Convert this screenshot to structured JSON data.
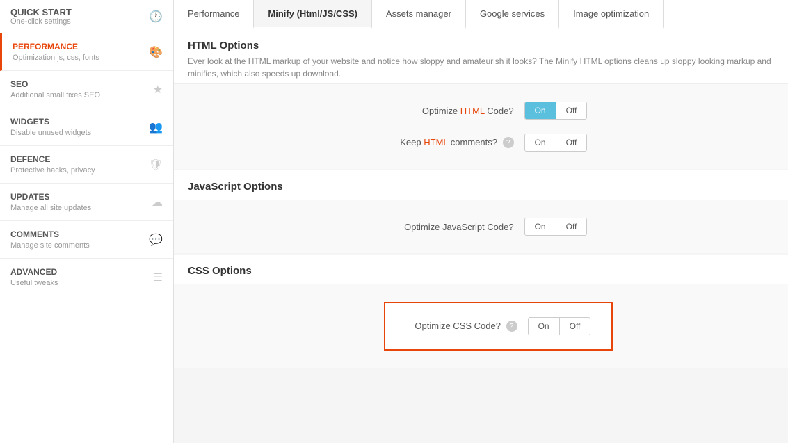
{
  "sidebar": {
    "quick_start": {
      "title": "QUICK START",
      "subtitle": "One-click settings"
    },
    "items": [
      {
        "id": "performance",
        "title": "PERFORMANCE",
        "subtitle": "Optimization js, css, fonts",
        "icon": "🎨",
        "active": true
      },
      {
        "id": "seo",
        "title": "SEO",
        "subtitle": "Additional small fixes SEO",
        "icon": "★",
        "active": false
      },
      {
        "id": "widgets",
        "title": "WIDGETS",
        "subtitle": "Disable unused widgets",
        "icon": "👥",
        "active": false
      },
      {
        "id": "defence",
        "title": "DEFENCE",
        "subtitle": "Protective hacks, privacy",
        "icon": "🛡",
        "active": false
      },
      {
        "id": "updates",
        "title": "UPDATES",
        "subtitle": "Manage all site updates",
        "icon": "☁",
        "active": false
      },
      {
        "id": "comments",
        "title": "COMMENTS",
        "subtitle": "Manage site comments",
        "icon": "💬",
        "active": false
      },
      {
        "id": "advanced",
        "title": "ADVANCED",
        "subtitle": "Useful tweaks",
        "icon": "☰",
        "active": false
      }
    ]
  },
  "tabs": [
    {
      "id": "performance",
      "label": "Performance",
      "active": false
    },
    {
      "id": "minify",
      "label": "Minify (Html/JS/CSS)",
      "active": true
    },
    {
      "id": "assets",
      "label": "Assets manager",
      "active": false
    },
    {
      "id": "google",
      "label": "Google services",
      "active": false
    },
    {
      "id": "image",
      "label": "Image optimization",
      "active": false
    }
  ],
  "sections": {
    "html_options": {
      "title": "HTML Options",
      "description": "Ever look at the HTML markup of your website and notice how sloppy and amateurish it looks? The Minify HTML options cleans up sloppy looking markup and minifies, which also speeds up download.",
      "optimize_html": {
        "label_prefix": "Optimize ",
        "label_highlight": "HTML",
        "label_suffix": " Code?",
        "on_label": "On",
        "off_label": "Off",
        "on_active": true
      },
      "keep_html_comments": {
        "label_prefix": "Keep ",
        "label_highlight": "HTML",
        "label_suffix": " comments?",
        "on_label": "On",
        "off_label": "Off",
        "on_active": false,
        "has_help": true
      }
    },
    "js_options": {
      "title": "JavaScript Options",
      "optimize_js": {
        "label": "Optimize JavaScript Code?",
        "on_label": "On",
        "off_label": "Off",
        "on_active": false
      }
    },
    "css_options": {
      "title": "CSS Options",
      "optimize_css": {
        "label_prefix": "Optimize CSS Code?",
        "on_label": "On",
        "off_label": "Off",
        "on_active": false,
        "has_help": true,
        "highlighted": true
      }
    }
  },
  "icons": {
    "clock": "🕐",
    "star": "★",
    "paint": "🎨",
    "people": "👥",
    "shield": "🛡",
    "cloud": "☁",
    "chat": "💬",
    "list": "☰",
    "question": "?"
  }
}
